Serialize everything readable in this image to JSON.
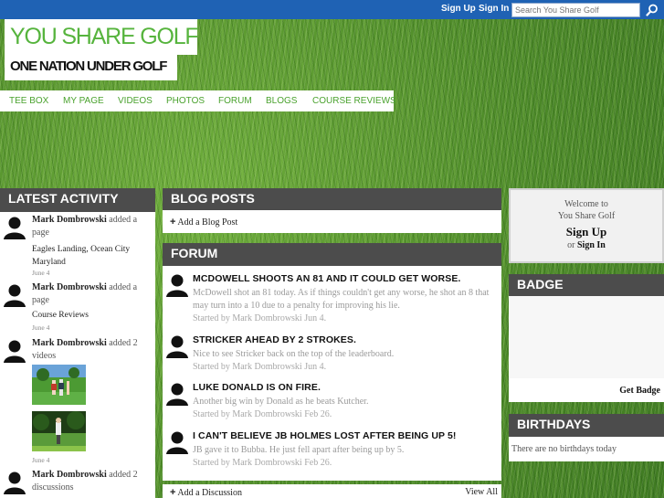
{
  "topbar": {
    "signup_label": "Sign Up",
    "signin_label": "Sign In",
    "search_placeholder": "Search You Share Golf"
  },
  "header": {
    "site_title": "YOU SHARE GOLF",
    "tagline": "ONE NATION UNDER GOLF"
  },
  "nav": {
    "items": [
      "TEE BOX",
      "MY PAGE",
      "VIDEOS",
      "PHOTOS",
      "FORUM",
      "BLOGS",
      "COURSE REVIEWS"
    ]
  },
  "activity": {
    "title": "LATEST ACTIVITY",
    "items": [
      {
        "name": "Mark Dombrowski",
        "action": "added a page",
        "subject": "Eagles Landing, Ocean City Maryland",
        "date": "June 4"
      },
      {
        "name": "Mark Dombrowski",
        "action": "added a page",
        "subject": "Course Reviews",
        "date": "June 4"
      },
      {
        "name": "Mark Dombrowski",
        "action": "added 2 videos",
        "subject": "",
        "date": "June 4"
      },
      {
        "name": "Mark Dombrowski",
        "action": "added 2 discussions",
        "subject": "",
        "date": ""
      }
    ]
  },
  "blog": {
    "title": "BLOG POSTS",
    "add_label": "Add a Blog Post"
  },
  "forum": {
    "title": "FORUM",
    "items": [
      {
        "title": "MCDOWELL SHOOTS AN 81 AND IT COULD GET WORSE.",
        "body": "McDowell shot an 81 today. As if things couldn't get any worse, he shot an 8 that may turn into a 10 due to a penalty for improving his lie.",
        "meta": "Started by Mark Dombrowski Jun 4."
      },
      {
        "title": "STRICKER AHEAD BY 2 STROKES.",
        "body": "Nice to see Stricker back on the top of the leaderboard.",
        "meta": "Started by Mark Dombrowski Jun 4."
      },
      {
        "title": "LUKE DONALD IS ON FIRE.",
        "body": "Another big win by Donald as he beats Kutcher.",
        "meta": "Started by Mark Dombrowski Feb 26."
      },
      {
        "title": "I CAN'T BELIEVE JB HOLMES LOST AFTER BEING UP 5!",
        "body": "JB gave it to Bubba. He just fell apart after being up by 5.",
        "meta": "Started by Mark Dombrowski Feb 26."
      }
    ],
    "add_label": "Add a Discussion",
    "view_all_label": "View All"
  },
  "welcome": {
    "line1": "Welcome to",
    "line2": "You Share Golf",
    "signup_label": "Sign Up",
    "or_text": "or",
    "signin_label": "Sign In"
  },
  "badge": {
    "title": "BADGE",
    "get_label": "Get Badge"
  },
  "birthdays": {
    "title": "BIRTHDAYS",
    "empty_text": "There are no birthdays today"
  },
  "colors": {
    "topbar": "#1f62b4",
    "brand_green": "#56b43d",
    "panel_header": "#4c4c4c"
  }
}
